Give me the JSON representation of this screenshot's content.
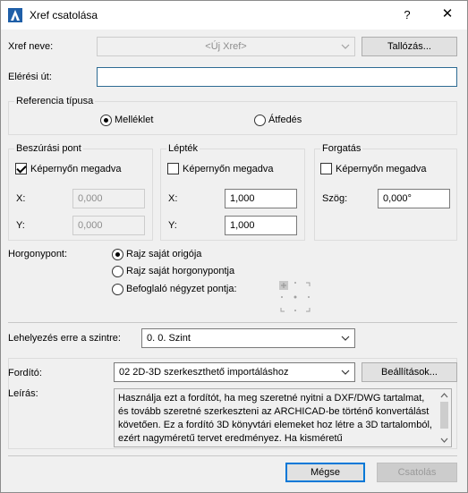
{
  "window": {
    "title": "Xref csatolása",
    "help_label": "?",
    "close_label": "✕"
  },
  "xref_name": {
    "label": "Xref neve:",
    "value": "<Új Xref>",
    "browse_label": "Tallózás..."
  },
  "path": {
    "label": "Elérési út:",
    "value": ""
  },
  "reference_type": {
    "title": "Referencia típusa",
    "options": [
      "Melléklet",
      "Átfedés"
    ],
    "selected": "Melléklet"
  },
  "insertion_point": {
    "title": "Beszúrási pont",
    "checkbox_label": "Képernyőn megadva",
    "checked": true,
    "x_label": "X:",
    "x_value": "0,000",
    "y_label": "Y:",
    "y_value": "0,000"
  },
  "scale": {
    "title": "Lépték",
    "checkbox_label": "Képernyőn megadva",
    "checked": false,
    "x_label": "X:",
    "x_value": "1,000",
    "y_label": "Y:",
    "y_value": "1,000"
  },
  "rotation": {
    "title": "Forgatás",
    "checkbox_label": "Képernyőn megadva",
    "checked": false,
    "angle_label": "Szög:",
    "angle_value": "0,000°"
  },
  "anchor": {
    "label": "Horgonypont:",
    "options": [
      "Rajz saját origója",
      "Rajz saját horgonypontja",
      "Befoglaló négyzet pontja:"
    ],
    "selected": "Rajz saját origója"
  },
  "story": {
    "label": "Lehelyezés erre a szintre:",
    "value": "0. 0. Szint"
  },
  "translator": {
    "label": "Fordító:",
    "value": "02 2D-3D szerkeszthető importáláshoz",
    "settings_label": "Beállítások...",
    "description_label": "Leírás:",
    "description": "Használja ezt a fordítót, ha meg szeretné nyitni a DXF/DWG tartalmat, és tovább szeretné szerkeszteni az ARCHICAD-be történő konvertálást követően. Ez a fordító 3D könyvtári elemeket hoz létre a 3D tartalomból, ezért nagyméretű tervet eredményez. Ha kisméretű"
  },
  "footer": {
    "cancel_label": "Mégse",
    "attach_label": "Csatolás"
  },
  "colors": {
    "accent": "#0078d7",
    "focus_border": "#2d6b93"
  }
}
